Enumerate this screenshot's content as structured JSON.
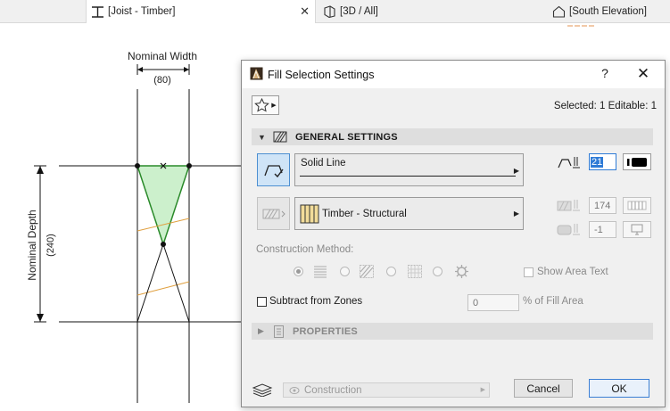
{
  "tabs": [
    {
      "label": "[Joist - Timber]",
      "icon": "joist-icon",
      "active": true
    },
    {
      "label": "[3D / All]",
      "icon": "3d-view-icon",
      "active": false
    },
    {
      "label": "[South Elevation]",
      "icon": "elevation-icon",
      "active": false
    }
  ],
  "drawing": {
    "nominal_width_label": "Nominal Width",
    "nominal_width_value": "(80)",
    "nominal_depth_label": "Nominal Depth",
    "nominal_depth_value": "(240)",
    "fill_color": "#ccf0cc",
    "outline_color": "#2a8a2a",
    "hatch_color": "#e0a040"
  },
  "dialog": {
    "title": "Fill Selection Settings",
    "help_label": "?",
    "close_label": "✕",
    "selected_text": "Selected: 1 Editable: 1",
    "general": {
      "title": "GENERAL SETTINGS",
      "line_type": "Solid Line",
      "pen_value": "21",
      "fill_type": "Timber - Structural",
      "fg_pen_value": "174",
      "bg_pen_value": "-1",
      "construction_method_label": "Construction Method:",
      "show_area_text_label": "Show Area Text",
      "subtract_label": "Subtract from Zones",
      "subtract_value": "0",
      "percent_label": "% of Fill Area"
    },
    "properties_title": "PROPERTIES",
    "layer_value": "Construction",
    "cancel_label": "Cancel",
    "ok_label": "OK"
  }
}
